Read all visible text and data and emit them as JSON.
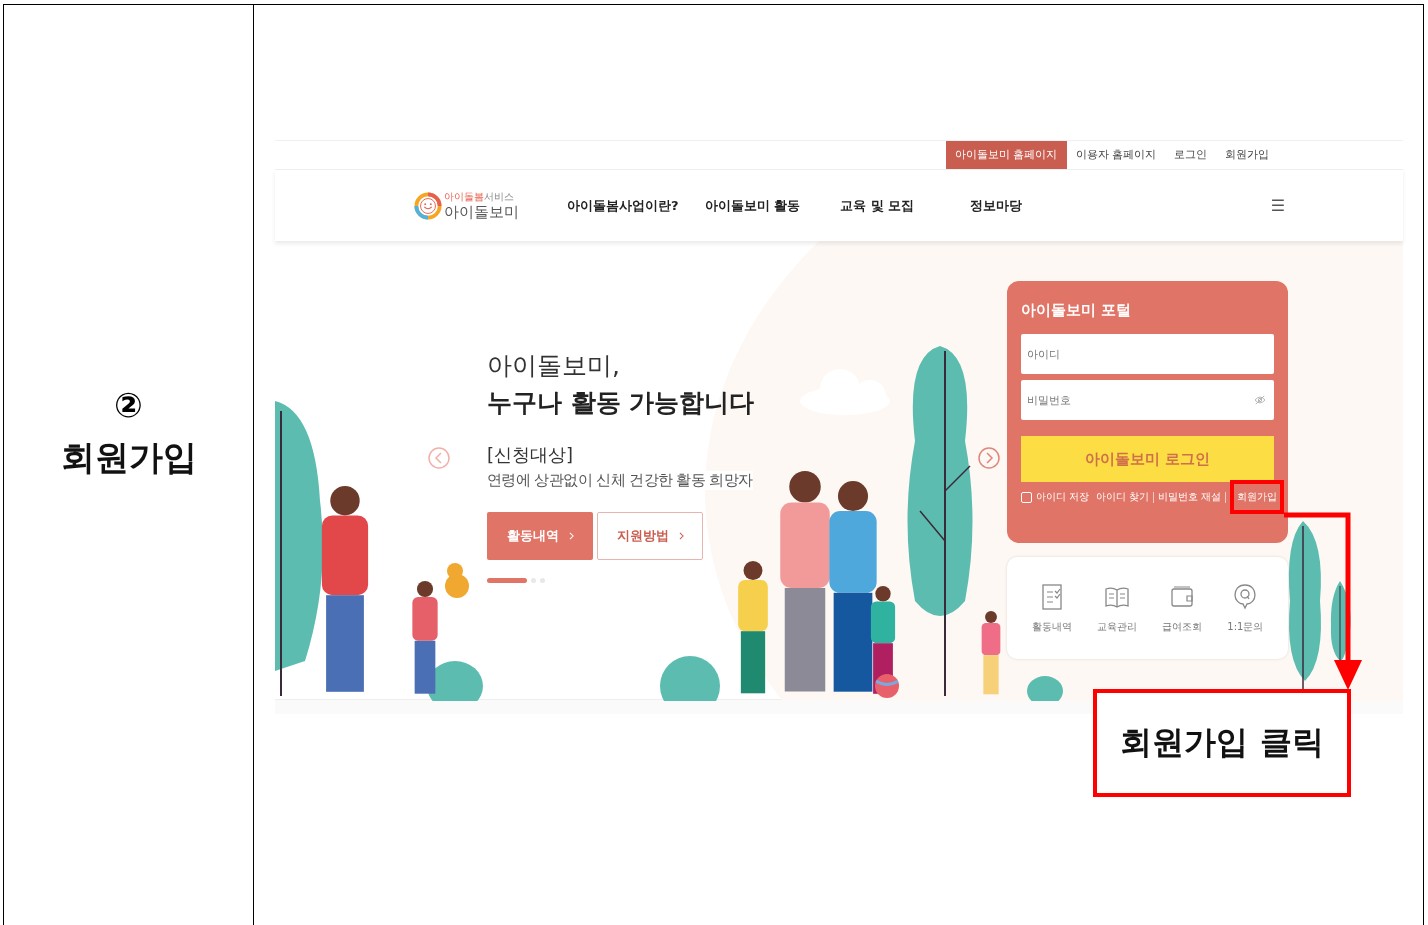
{
  "step": {
    "number": "②",
    "title": "회원가입"
  },
  "screenshot": {
    "top_links": [
      {
        "label": "아이돌보미 홈페이지",
        "selected": true
      },
      {
        "label": "이용자 홈페이지",
        "selected": false
      },
      {
        "label": "로그인",
        "selected": false
      },
      {
        "label": "회원가입",
        "selected": false
      }
    ],
    "logo": {
      "tagline_parts": [
        "아이돌봄",
        "서비스"
      ],
      "name": "아이돌보미"
    },
    "nav": [
      "아이돌봄사업이란?",
      "아이돌보미 활동",
      "교육 및 모집",
      "정보마당"
    ],
    "menu_icon": "☰",
    "hero": {
      "title_line1": "아이돌보미,",
      "title_line2": "누구나 활동 가능합니다",
      "subtitle": "[신청대상]",
      "description": "연령에 상관없이 신체 건강한 활동 희망자",
      "buttons": [
        {
          "label": "활동내역",
          "kind": "filled"
        },
        {
          "label": "지원방법",
          "kind": "outline"
        }
      ],
      "slides": [
        {
          "selected": true
        },
        {
          "selected": false
        },
        {
          "selected": false
        }
      ]
    },
    "login": {
      "title": "아이돌보미 포털",
      "id_placeholder": "아이디",
      "password_placeholder": "비밀번호",
      "login_button": "아이돌보미 로그인",
      "remember": {
        "label": "아이디 저장",
        "checked": false
      },
      "links": [
        {
          "label": "아이디 찾기",
          "highlighted": false
        },
        {
          "label": "비밀번호 재설",
          "highlighted": false
        },
        {
          "label": "회원가입",
          "highlighted": true
        }
      ]
    },
    "quick_menu": [
      {
        "label": "활동내역"
      },
      {
        "label": "교육관리"
      },
      {
        "label": "급여조회"
      },
      {
        "label": "1:1문의"
      }
    ]
  },
  "callout": {
    "text": "회원가입 클릭"
  }
}
